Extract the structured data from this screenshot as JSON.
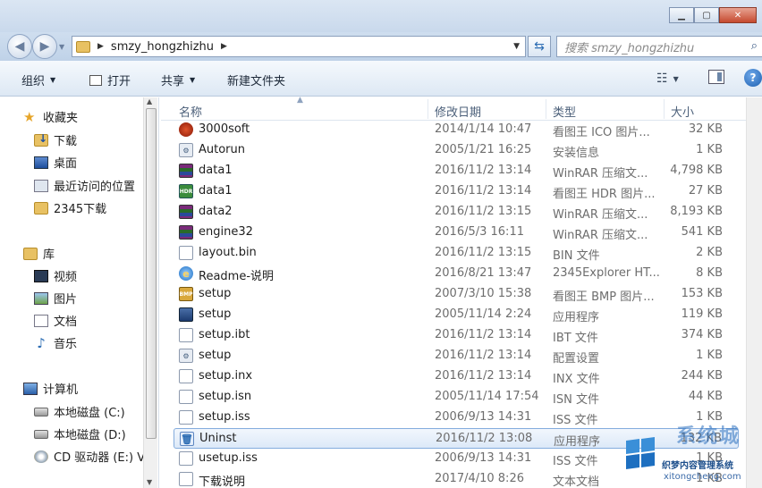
{
  "address": {
    "breadcrumb": "smzy_hongzhizhu",
    "search_placeholder": "搜索 smzy_hongzhizhu"
  },
  "toolbar": {
    "organize": "组织",
    "open": "打开",
    "share": "共享",
    "new_folder": "新建文件夹"
  },
  "nav": {
    "favorites": "收藏夹",
    "downloads": "下载",
    "desktop": "桌面",
    "recent": "最近访问的位置",
    "downloads2345": "2345下载",
    "libraries": "库",
    "videos": "视频",
    "pictures": "图片",
    "documents": "文档",
    "music": "音乐",
    "computer": "计算机",
    "drive_c": "本地磁盘 (C:)",
    "drive_d": "本地磁盘 (D:)",
    "drive_e": "CD 驱动器 (E:) V"
  },
  "columns": {
    "name": "名称",
    "date": "修改日期",
    "type": "类型",
    "size": "大小"
  },
  "files": [
    {
      "name": "3000soft",
      "date": "2014/1/14 10:47",
      "type": "看图王 ICO 图片...",
      "size": "32 KB",
      "icon": "app-icon"
    },
    {
      "name": "Autorun",
      "date": "2005/1/21 16:25",
      "type": "安装信息",
      "size": "1 KB",
      "icon": "inf-icon"
    },
    {
      "name": "data1",
      "date": "2016/11/2 13:14",
      "type": "WinRAR 压缩文...",
      "size": "4,798 KB",
      "icon": "rar-icon"
    },
    {
      "name": "data1",
      "date": "2016/11/2 13:14",
      "type": "看图王 HDR 图片...",
      "size": "27 KB",
      "icon": "hdr-icon"
    },
    {
      "name": "data2",
      "date": "2016/11/2 13:15",
      "type": "WinRAR 压缩文...",
      "size": "8,193 KB",
      "icon": "rar-icon"
    },
    {
      "name": "engine32",
      "date": "2016/5/3 16:11",
      "type": "WinRAR 压缩文...",
      "size": "541 KB",
      "icon": "rar-icon"
    },
    {
      "name": "layout.bin",
      "date": "2016/11/2 13:15",
      "type": "BIN 文件",
      "size": "2 KB",
      "icon": "file-icon"
    },
    {
      "name": "Readme-说明",
      "date": "2016/8/21 13:47",
      "type": "2345Explorer HT...",
      "size": "8 KB",
      "icon": "browser-icon"
    },
    {
      "name": "setup",
      "date": "2007/3/10 15:38",
      "type": "看图王 BMP 图片...",
      "size": "153 KB",
      "icon": "bmp-icon"
    },
    {
      "name": "setup",
      "date": "2005/11/14 2:24",
      "type": "应用程序",
      "size": "119 KB",
      "icon": "exe-icon"
    },
    {
      "name": "setup.ibt",
      "date": "2016/11/2 13:14",
      "type": "IBT 文件",
      "size": "374 KB",
      "icon": "file-icon"
    },
    {
      "name": "setup",
      "date": "2016/11/2 13:14",
      "type": "配置设置",
      "size": "1 KB",
      "icon": "config-icon"
    },
    {
      "name": "setup.inx",
      "date": "2016/11/2 13:14",
      "type": "INX 文件",
      "size": "244 KB",
      "icon": "file-icon"
    },
    {
      "name": "setup.isn",
      "date": "2005/11/14 17:54",
      "type": "ISN 文件",
      "size": "44 KB",
      "icon": "file-icon"
    },
    {
      "name": "setup.iss",
      "date": "2006/9/13 14:31",
      "type": "ISS 文件",
      "size": "1 KB",
      "icon": "file-icon"
    },
    {
      "name": "Uninst",
      "date": "2016/11/2 13:08",
      "type": "应用程序",
      "size": "132 KB",
      "icon": "uninstall-icon",
      "selected": true
    },
    {
      "name": "usetup.iss",
      "date": "2006/9/13 14:31",
      "type": "ISS 文件",
      "size": "1 KB",
      "icon": "file-icon"
    },
    {
      "name": "下载说明",
      "date": "2017/4/10 8:26",
      "type": "文本文档",
      "size": "1 KB",
      "icon": "text-file-icon"
    }
  ],
  "watermark": {
    "big": "系统城",
    "line": "织梦内容管理系统",
    "url": "xitongcheng.com"
  }
}
